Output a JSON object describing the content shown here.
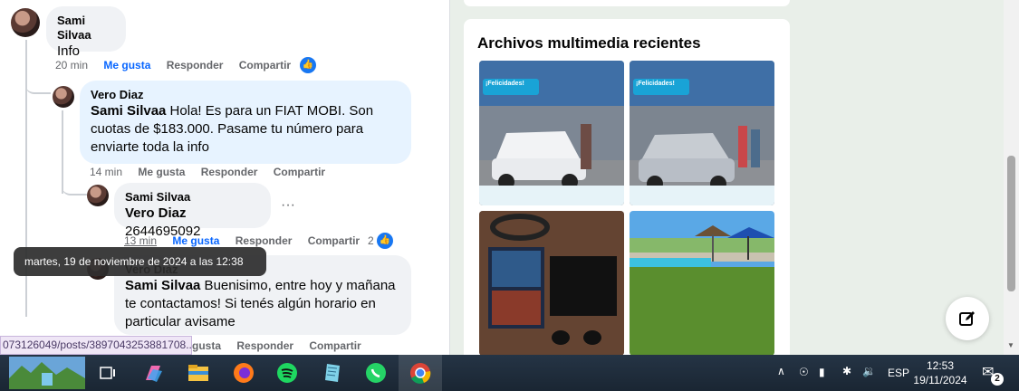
{
  "comments": [
    {
      "author": "Sami Silvaa",
      "text": "Info",
      "time": "20 min",
      "like": "Me gusta",
      "reply": "Responder",
      "share": "Compartir"
    },
    {
      "author": "Vero Diaz",
      "mention": "Sami Silvaa",
      "text": " Hola! Es para un FIAT MOBI. Son cuotas de $183.000. Pasame tu número para enviarte toda la info",
      "time": "14 min",
      "like": "Me gusta",
      "reply": "Responder",
      "share": "Compartir"
    },
    {
      "author": "Sami Silvaa",
      "mention": "Vero Diaz",
      "text": " 2644695092",
      "time": "13 min",
      "like": "Me gusta",
      "reply": "Responder",
      "share": "Compartir",
      "reactions": "2",
      "more": "···"
    },
    {
      "author": "Vero Diaz",
      "mention": "Sami Silvaa",
      "text": " Buenisimo, entre hoy y mañana te contactamos! Si tenés algún horario en particular avisame",
      "like": "gusta",
      "reply": "Responder",
      "share": "Compartir"
    }
  ],
  "tooltip": "martes, 19 de noviembre de 2024 a las 12:38",
  "status_url": "073126049/posts/3897043253881708...",
  "media": {
    "title": "Archivos multimedia recientes",
    "banner_text": "¡Felicidades!"
  },
  "taskbar": {
    "language": "ESP",
    "time": "12:53",
    "date": "19/11/2024",
    "notifications": "2"
  },
  "colors": {
    "facebook_blue": "#0866ff",
    "bubble": "#f0f2f5",
    "bubble_highlight": "#e7f3ff"
  }
}
